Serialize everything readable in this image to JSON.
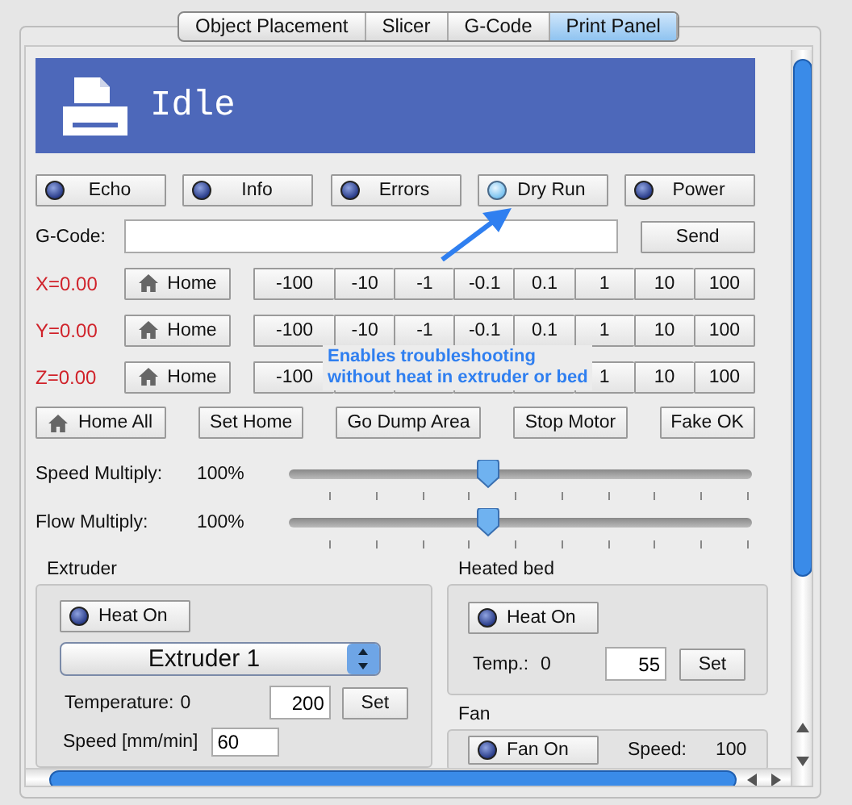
{
  "tabs": [
    {
      "label": "Object Placement",
      "selected": false
    },
    {
      "label": "Slicer",
      "selected": false
    },
    {
      "label": "G-Code",
      "selected": false
    },
    {
      "label": "Print Panel",
      "selected": true
    }
  ],
  "status": {
    "text": "Idle"
  },
  "toggles": [
    {
      "label": "Echo",
      "on": false
    },
    {
      "label": "Info",
      "on": false
    },
    {
      "label": "Errors",
      "on": false
    },
    {
      "label": "Dry Run",
      "on": true
    },
    {
      "label": "Power",
      "on": false
    }
  ],
  "gcode": {
    "label": "G-Code:",
    "button": "Send"
  },
  "axes": [
    {
      "label": "X=0.00",
      "home": "Home",
      "steps": [
        {
          "kind": "step",
          "label": "-100"
        },
        {
          "kind": "step",
          "label": "-10"
        },
        {
          "kind": "step",
          "label": "-1"
        },
        {
          "kind": "step",
          "label": "-0.1"
        },
        {
          "kind": "step",
          "label": "0.1"
        },
        {
          "kind": "step",
          "label": "1"
        },
        {
          "kind": "step",
          "label": "10"
        },
        {
          "kind": "step",
          "label": "100"
        }
      ]
    },
    {
      "label": "Y=0.00",
      "home": "Home",
      "steps": [
        {
          "kind": "step",
          "label": "-100"
        },
        {
          "kind": "step",
          "label": "-10"
        },
        {
          "kind": "step",
          "label": "-1"
        },
        {
          "kind": "step",
          "label": "-0.1"
        },
        {
          "kind": "step",
          "label": "0.1"
        },
        {
          "kind": "step",
          "label": "1"
        },
        {
          "kind": "step",
          "label": "10"
        },
        {
          "kind": "step",
          "label": "100"
        }
      ]
    },
    {
      "label": "Z=0.00",
      "home": "Home",
      "steps": [
        {
          "kind": "step",
          "label": "-100"
        },
        {
          "kind": "covered"
        },
        {
          "kind": "covered"
        },
        {
          "kind": "covered"
        },
        {
          "kind": "covered"
        },
        {
          "kind": "step",
          "label": "1"
        },
        {
          "kind": "step",
          "label": "10"
        },
        {
          "kind": "step",
          "label": "100"
        }
      ]
    }
  ],
  "actions": [
    {
      "label": "Home All",
      "kind": "home"
    },
    {
      "label": "Set Home",
      "kind": "plain"
    },
    {
      "label": "Go Dump Area",
      "kind": "plain"
    },
    {
      "label": "Stop Motor",
      "kind": "plain"
    },
    {
      "label": "Fake OK",
      "kind": "plain"
    }
  ],
  "sliders": [
    {
      "label": "Speed Multiply:",
      "reading": "100%",
      "level": 0.43
    },
    {
      "label": "Flow Multiply:",
      "reading": "100%",
      "level": 0.43
    }
  ],
  "annotation": {
    "text": "Enables troubleshooting\nwithout heat in extruder or bed"
  },
  "extruder": {
    "title": "Extruder",
    "heat": {
      "label": "Heat On",
      "on": false
    },
    "select": "Extruder 1",
    "temp_label": "Temperature:",
    "temp_reading": "0",
    "temp_value": "200",
    "set": "Set",
    "speed_label": "Speed [mm/min]",
    "speed_value": "60"
  },
  "bed": {
    "title": "Heated bed",
    "heat": {
      "label": "Heat On",
      "on": false
    },
    "temp_label": "Temp.:",
    "temp_reading": "0",
    "temp_value": "55",
    "set": "Set"
  },
  "fan": {
    "title": "Fan",
    "toggle": {
      "label": "Fan On",
      "on": false
    },
    "speed_label": "Speed:",
    "speed_reading": "100"
  }
}
